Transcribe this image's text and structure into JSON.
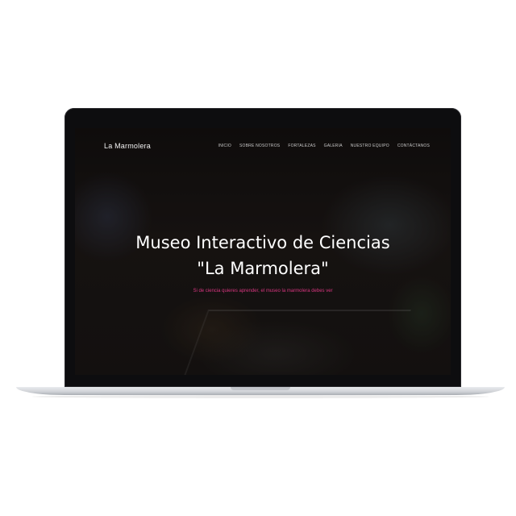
{
  "site": {
    "brand": "La Marmolera",
    "nav_items": [
      {
        "label": "INICIO"
      },
      {
        "label": "SOBRE NOSOTROS"
      },
      {
        "label": "FORTALEZAS"
      },
      {
        "label": "GALERIA"
      },
      {
        "label": "NUESTRO EQUIPO"
      },
      {
        "label": "CONTÁCTANOS"
      }
    ]
  },
  "hero": {
    "title_line1": "Museo Interactivo de Ciencias",
    "title_line2": "\"La Marmolera\"",
    "subtitle": "Si de ciencia quieres aprender, el museo la marmolera debes ver"
  },
  "colors": {
    "accent": "#d7357f",
    "nav_text": "#c9c9c9",
    "title_text": "#ffffff",
    "bezel": "#0d0d0f",
    "laptop_body": "#cfd2d6"
  }
}
